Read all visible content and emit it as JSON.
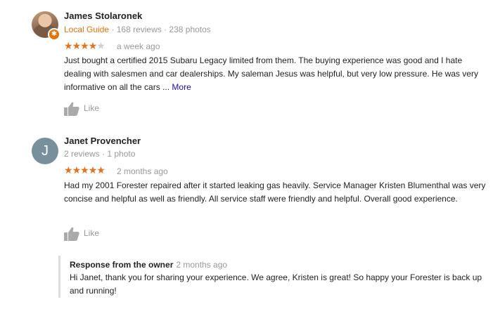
{
  "reviews": [
    {
      "name": "James Stolaronek",
      "guide_label": "Local Guide",
      "stats": "· 168 reviews · 238 photos",
      "rating": 4,
      "date": "a week ago",
      "text": "Just bought a certified 2015 Subaru Legacy limited from them. The buying experience was good and I hate dealing with salesmen and car dealerships. My saleman Jesus was helpful, but very low pressure. He was very informative on all the cars ...",
      "more_label": "More",
      "like_label": "Like"
    },
    {
      "name": "Janet Provencher",
      "avatar_letter": "J",
      "stats": "2 reviews · 1 photo",
      "rating": 5,
      "date": "2 months ago",
      "text": "Had my 2001 Forester repaired after it started leaking gas heavily. Service Manager Kristen Blumenthal was very concise and helpful as well as friendly. All service staff were friendly and helpful. Overall good experience.",
      "like_label": "Like",
      "owner_response": {
        "title": "Response from the owner",
        "date": "2 months ago",
        "text": "Hi Janet, thank you for sharing your experience. We agree, Kristen is great! So happy your Forester is back up and running!"
      }
    }
  ],
  "colors": {
    "star": "#e7711b",
    "guide": "#e8710a",
    "link": "#1a0dab",
    "muted": "#999999"
  },
  "icons": [
    "thumbs-up-icon",
    "local-guide-badge-icon",
    "star-icon"
  ]
}
